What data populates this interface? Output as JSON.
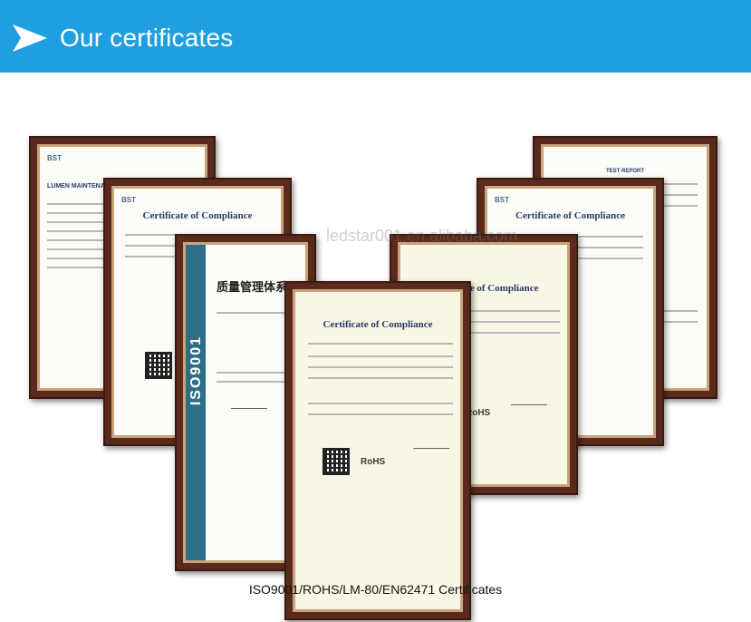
{
  "banner": {
    "title": "Our certificates",
    "icon": "arrow-right-icon",
    "color": "#1f9fe0"
  },
  "certificates": [
    {
      "title": "LUMEN MAINTENANCE IESNA LM"
    },
    {
      "title": "Certificate of Compliance"
    },
    {
      "title": "质量管理体系",
      "band": "ISO9001"
    },
    {
      "title": "Certificate of Compliance",
      "badge": "RoHS"
    },
    {
      "title": "Certificate of Compliance",
      "badge": "RoHS"
    },
    {
      "title": "Certificate of Compliance"
    },
    {
      "title": "TEST REPORT"
    }
  ],
  "caption": "ISO9001/ROHS/LM-80/EN62471 Certificates",
  "watermark": "ledstar001.en.alibaba.com"
}
